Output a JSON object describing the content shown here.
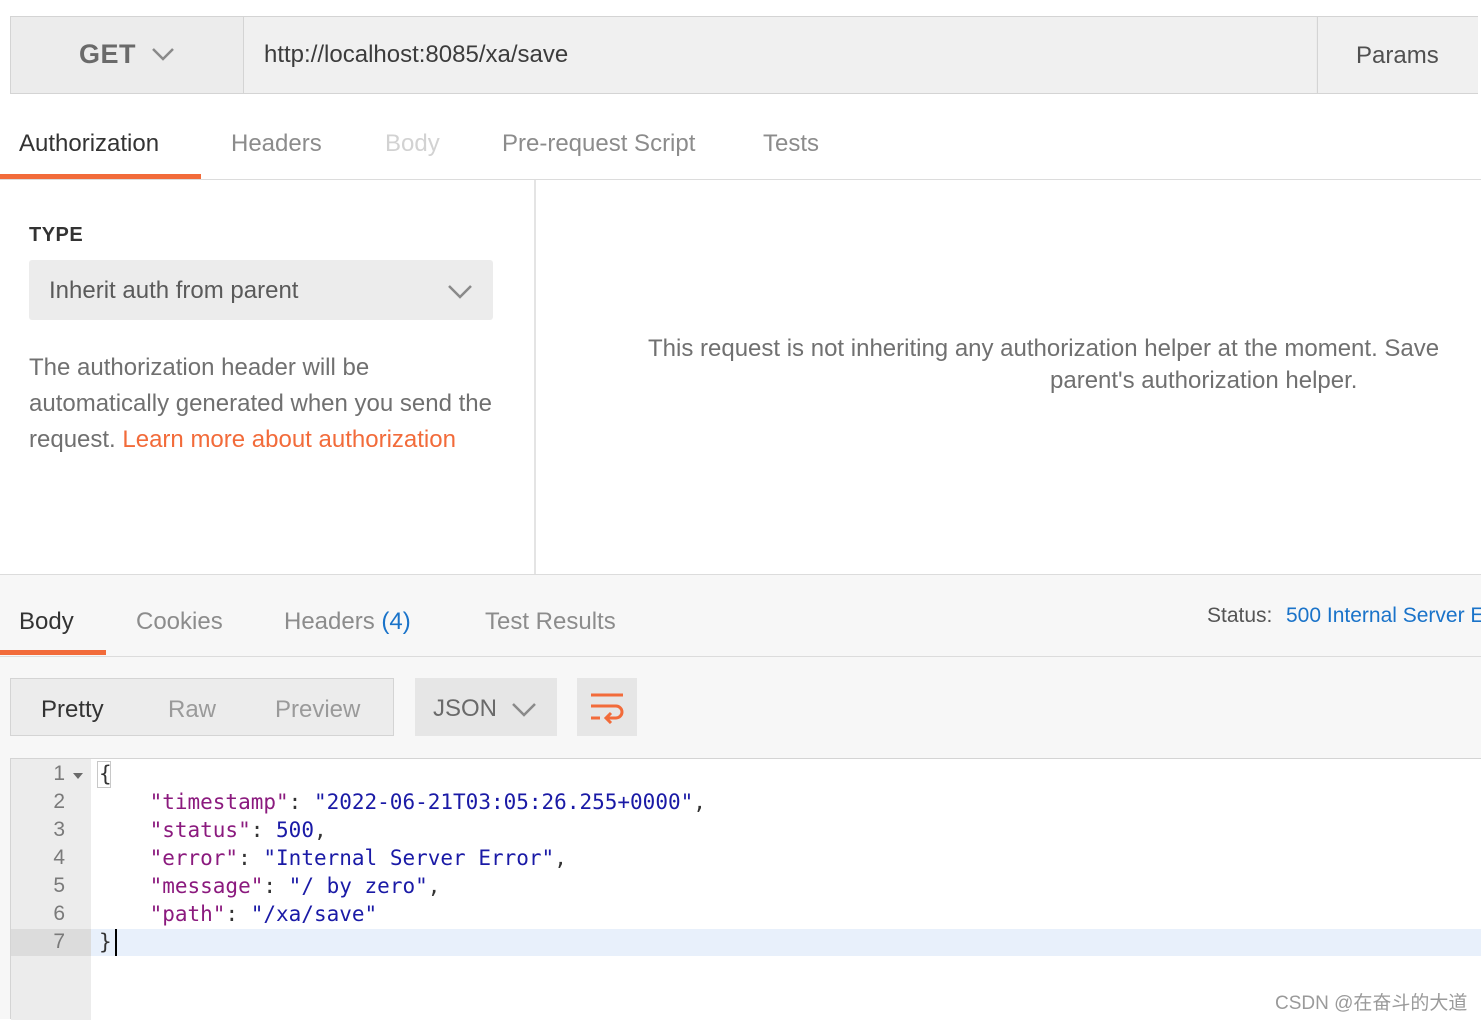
{
  "request": {
    "method": "GET",
    "url": "http://localhost:8085/xa/save",
    "params_label": "Params"
  },
  "request_tabs": [
    "Authorization",
    "Headers",
    "Body",
    "Pre-request Script",
    "Tests"
  ],
  "auth": {
    "type_label": "TYPE",
    "type_value": "Inherit auth from parent",
    "description": "The authorization header will be automatically generated when you send the request. ",
    "learn_more": "Learn more about authorization",
    "info_line1": "This request is not inheriting any authorization helper at the moment. Save",
    "info_line2": "parent's authorization helper."
  },
  "response": {
    "tabs": {
      "body": "Body",
      "cookies": "Cookies",
      "headers": "Headers",
      "headers_count": "(4)",
      "test_results": "Test Results"
    },
    "status_label": "Status:",
    "status_value": "500 Internal Server E",
    "format_buttons": [
      "Pretty",
      "Raw",
      "Preview"
    ],
    "language": "JSON",
    "line_numbers": [
      "1",
      "2",
      "3",
      "4",
      "5",
      "6",
      "7"
    ],
    "body_json": {
      "open": "{",
      "close": "}",
      "timestamp_key": "\"timestamp\"",
      "timestamp_value": "\"2022-06-21T03:05:26.255+0000\"",
      "status_key": "\"status\"",
      "status_value": "500",
      "error_key": "\"error\"",
      "error_value": "\"Internal Server Error\"",
      "message_key": "\"message\"",
      "message_value": "\"/ by zero\"",
      "path_key": "\"path\"",
      "path_value": "\"/xa/save\""
    }
  },
  "watermark": "CSDN @在奋斗的大道",
  "colors": {
    "accent": "#f26b3a",
    "link_blue": "#1a73c9",
    "json_key": "#8b1a7e",
    "json_value": "#1a1aa6"
  }
}
